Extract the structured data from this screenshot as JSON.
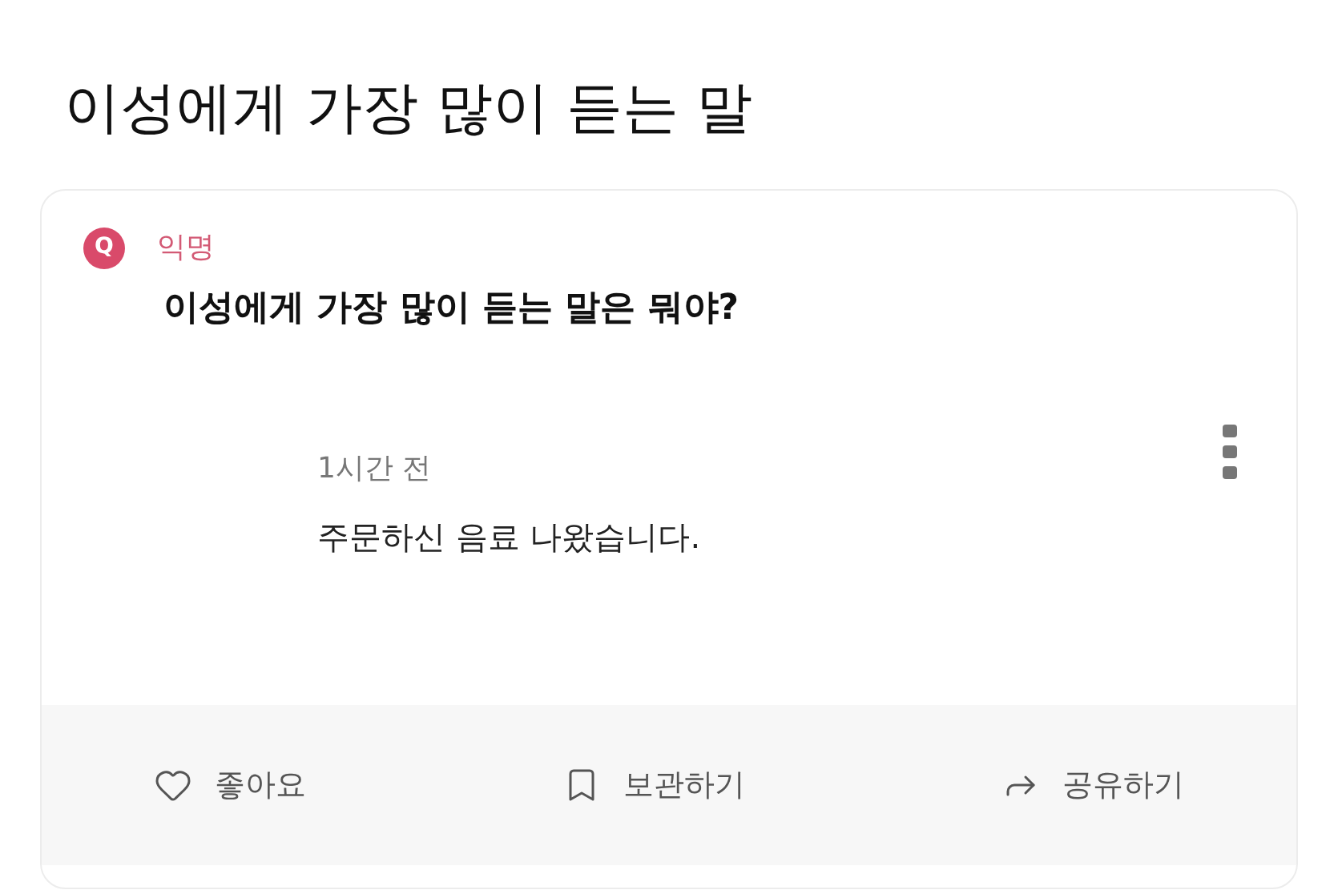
{
  "page_title": "이성에게 가장 많이 듣는 말",
  "post": {
    "avatar": "Q",
    "author": "익명",
    "question": "이성에게 가장 많이 듣는 말은 뭐야?",
    "answer": {
      "time": "1시간 전",
      "text": "주문하신 음료 나왔습니다."
    }
  },
  "actions": [
    {
      "kind": "like",
      "label": "좋아요"
    },
    {
      "kind": "bookmark",
      "label": "보관하기"
    },
    {
      "kind": "share",
      "label": "공유하기"
    }
  ]
}
